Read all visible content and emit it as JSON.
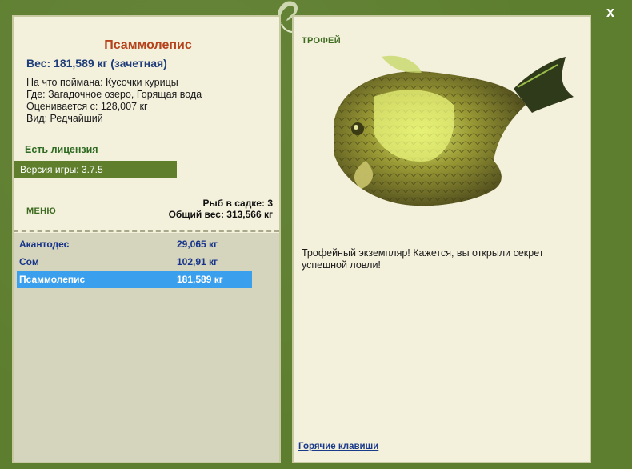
{
  "window": {
    "close_label": "x"
  },
  "fish": {
    "name": "Псаммолепис",
    "weight": "Вес: 181,589 кг (зачетная)",
    "caught_on": "На что поймана: Кусочки курицы",
    "location": "Где: Загадочное озеро, Горящая вода",
    "valued_from": "Оценивается с: 128,007 кг",
    "kind": "Вид: Редчайший"
  },
  "license": "Есть лицензия",
  "version": "Версия игры: 3.7.5",
  "menu_label": "МЕНЮ",
  "keepnet": {
    "count": "Рыб в садке: 3",
    "total": "Общий вес: 313,566 кг",
    "items": [
      {
        "name": "Акантодес",
        "weight": "29,065 кг",
        "selected": false
      },
      {
        "name": "Сом",
        "weight": "102,91 кг",
        "selected": false
      },
      {
        "name": "Псаммолепис",
        "weight": "181,589 кг",
        "selected": true
      }
    ]
  },
  "trophy": {
    "label": "ТРОФЕЙ",
    "description": "Трофейный экземпляр! Кажется, вы открыли секрет успешной ловли!"
  },
  "hotkeys_label": "Горячие клавиши",
  "colors": {
    "frame": "#5e7e2f",
    "panel": "#f3f0dc",
    "title": "#b5421a",
    "selected_row": "#3aa0ee"
  }
}
